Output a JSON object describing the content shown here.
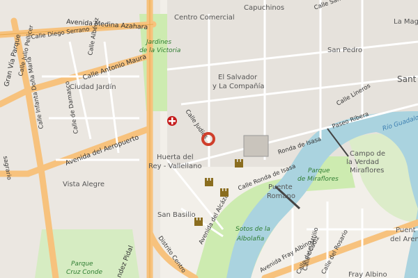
{
  "map": {
    "districts": [
      {
        "key": "capuchinos",
        "label": "Capuchinos"
      },
      {
        "key": "centro_comercial",
        "label": "Centro Comercial"
      },
      {
        "key": "san_pedro",
        "label": "San Pedro"
      },
      {
        "key": "el_salvador",
        "label": "El Salvador"
      },
      {
        "key": "la_compania",
        "label": "y La Compañía"
      },
      {
        "key": "ciudad_jardin",
        "label": "Ciudad Jardín"
      },
      {
        "key": "huerta_rey",
        "label": "Huerta del"
      },
      {
        "key": "huerta_rey2",
        "label": "Rey - Vallellano"
      },
      {
        "key": "vista_alegre",
        "label": "Vista Alegre"
      },
      {
        "key": "san_basilio",
        "label": "San Basilio"
      },
      {
        "key": "campo_verdad",
        "label": "Campo de"
      },
      {
        "key": "campo_verdad2",
        "label": "la Verdad"
      },
      {
        "key": "campo_verdad3",
        "label": "Miraflores"
      },
      {
        "key": "la_magd",
        "label": "La Mag"
      },
      {
        "key": "sant",
        "label": "Sant"
      },
      {
        "key": "puente_romano",
        "label": "Puente"
      },
      {
        "key": "puente_romano2",
        "label": "Romano"
      },
      {
        "key": "fray_albino",
        "label": "Fray Albino"
      },
      {
        "key": "puente_arenal",
        "label": "Puent"
      },
      {
        "key": "puente_arenal2",
        "label": "del Aren"
      }
    ],
    "streets": [
      {
        "key": "medina_azahara",
        "label": "Avenida Medina Azahara"
      },
      {
        "key": "gran_via_parque",
        "label": "Gran Vía Parque"
      },
      {
        "key": "diego_serrano",
        "label": "Calle Diego Serrano"
      },
      {
        "key": "julio_pellicer",
        "label": "Calle Julio Pellicer"
      },
      {
        "key": "albeniz",
        "label": "Calle Albéniz"
      },
      {
        "key": "antonio_maura",
        "label": "Calle Antonio Maura"
      },
      {
        "key": "infanta_dona_maria",
        "label": "Calle Infanta Doña María"
      },
      {
        "key": "damasco",
        "label": "Calle de Damasco"
      },
      {
        "key": "aeropuerto",
        "label": "Avenida del Aeropuerto"
      },
      {
        "key": "judios",
        "label": "Calle Judíos"
      },
      {
        "key": "lineros",
        "label": "Calle Lineros"
      },
      {
        "key": "paseo_ribera",
        "label": "Paseo Ribera"
      },
      {
        "key": "ronda_isasa",
        "label": "Ronda de Isasa"
      },
      {
        "key": "calle_ronda_isasa",
        "label": "Calle Ronda de Isasa"
      },
      {
        "key": "alcazar",
        "label": "Avenida del Alcázar"
      },
      {
        "key": "calle_san",
        "label": "Calle San Pa"
      },
      {
        "key": "distrito_centro",
        "label": "Distrito Centro"
      },
      {
        "key": "fray_albino_av",
        "label": "Avenida Fray Albino"
      },
      {
        "key": "calle_cadiz",
        "label": "Calle de Cádiz"
      },
      {
        "key": "calle_rosario",
        "label": "Calle del Rosario"
      },
      {
        "key": "calle_attilio",
        "label": "Calle del Attilio"
      },
      {
        "key": "vazquez_pidal",
        "label": "ndez Pidal"
      },
      {
        "key": "sagrario",
        "label": "sagrario"
      }
    ],
    "parks": [
      {
        "key": "jardines_victoria",
        "label": "Jardines"
      },
      {
        "key": "jardines_victoria2",
        "label": "de la Victoria"
      },
      {
        "key": "sotos",
        "label": "Sotos de la"
      },
      {
        "key": "sotos2",
        "label": "Albolafia"
      },
      {
        "key": "parque_miraflores",
        "label": "Parque"
      },
      {
        "key": "parque_miraflores2",
        "label": "de Miraflores"
      },
      {
        "key": "parque_cruz_conde",
        "label": "Parque"
      },
      {
        "key": "parque_cruz_conde2",
        "label": "Cruz Conde"
      }
    ],
    "river": {
      "label": "Río Guadalquivir"
    },
    "colors": {
      "background": "#f2efe9",
      "river": "#aad3df",
      "park": "#cdebb0",
      "motorway": "#f7c27d",
      "road": "#ffffff",
      "marker": "#cf3e2b",
      "hospital": "#c51d1d"
    },
    "markers": [
      {
        "key": "location_pin",
        "icon": "location-pin-icon"
      },
      {
        "key": "hospital",
        "icon": "hospital-cross-icon"
      },
      {
        "key": "castle1",
        "icon": "castle-icon"
      },
      {
        "key": "castle2",
        "icon": "castle-icon"
      },
      {
        "key": "castle3",
        "icon": "castle-icon"
      },
      {
        "key": "castle4",
        "icon": "castle-icon"
      }
    ]
  }
}
